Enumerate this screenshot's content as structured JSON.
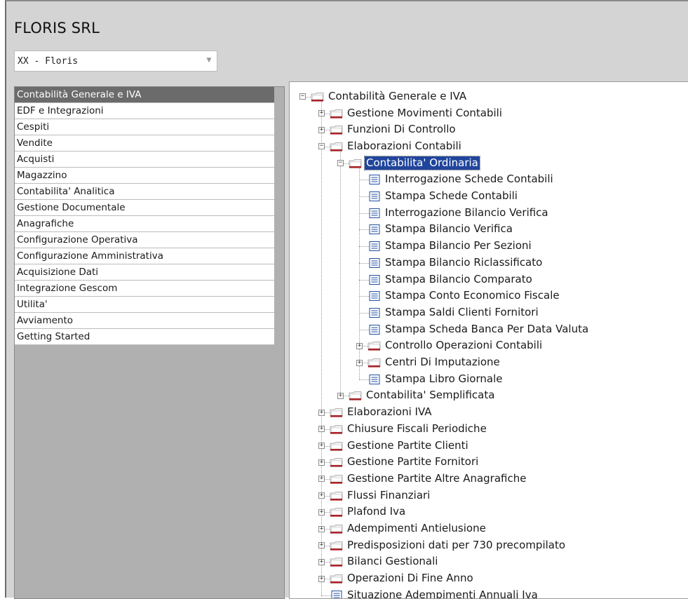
{
  "header": {
    "company_name": "FLORIS SRL",
    "company_select_value": "XX - Floris"
  },
  "left_menu": {
    "items": [
      {
        "label": "Contabilità Generale e IVA",
        "selected": true
      },
      {
        "label": "EDF e Integrazioni"
      },
      {
        "label": "Cespiti"
      },
      {
        "label": "Vendite"
      },
      {
        "label": "Acquisti"
      },
      {
        "label": "Magazzino"
      },
      {
        "label": "Contabilita' Analitica"
      },
      {
        "label": "Gestione Documentale"
      },
      {
        "label": "Anagrafiche"
      },
      {
        "label": "Configurazione Operativa"
      },
      {
        "label": "Configurazione Amministrativa"
      },
      {
        "label": "Acquisizione Dati"
      },
      {
        "label": "Integrazione Gescom"
      },
      {
        "label": "Utilita'"
      },
      {
        "label": "Avviamento"
      },
      {
        "label": "Getting Started"
      }
    ]
  },
  "tree": [
    {
      "label": "Contabilità Generale e IVA",
      "level": 0,
      "type": "folder",
      "expander": "-",
      "open": true
    },
    {
      "label": "Gestione Movimenti Contabili",
      "level": 1,
      "type": "folder",
      "expander": "+"
    },
    {
      "label": "Funzioni Di Controllo",
      "level": 1,
      "type": "folder",
      "expander": "+"
    },
    {
      "label": "Elaborazioni Contabili",
      "level": 1,
      "type": "folder",
      "expander": "-"
    },
    {
      "label": "Contabilita' Ordinaria",
      "level": 2,
      "type": "folder",
      "expander": "-",
      "selected": true
    },
    {
      "label": "Interrogazione Schede Contabili",
      "level": 3,
      "type": "leaf"
    },
    {
      "label": "Stampa Schede Contabili",
      "level": 3,
      "type": "leaf"
    },
    {
      "label": "Interrogazione Bilancio Verifica",
      "level": 3,
      "type": "leaf"
    },
    {
      "label": "Stampa Bilancio Verifica",
      "level": 3,
      "type": "leaf"
    },
    {
      "label": "Stampa Bilancio Per Sezioni",
      "level": 3,
      "type": "leaf"
    },
    {
      "label": "Stampa Bilancio Riclassificato",
      "level": 3,
      "type": "leaf"
    },
    {
      "label": "Stampa Bilancio Comparato",
      "level": 3,
      "type": "leaf"
    },
    {
      "label": "Stampa Conto Economico Fiscale",
      "level": 3,
      "type": "leaf"
    },
    {
      "label": "Stampa Saldi Clienti Fornitori",
      "level": 3,
      "type": "leaf"
    },
    {
      "label": "Stampa Scheda Banca Per Data Valuta",
      "level": 3,
      "type": "leaf"
    },
    {
      "label": "Controllo Operazioni Contabili",
      "level": 3,
      "type": "folder",
      "expander": "+"
    },
    {
      "label": "Centri Di Imputazione",
      "level": 3,
      "type": "folder",
      "expander": "+"
    },
    {
      "label": "Stampa Libro Giornale",
      "level": 3,
      "type": "leaf"
    },
    {
      "label": "Contabilita' Semplificata",
      "level": 2,
      "type": "folder",
      "expander": "+"
    },
    {
      "label": "Elaborazioni IVA",
      "level": 1,
      "type": "folder",
      "expander": "+"
    },
    {
      "label": "Chiusure Fiscali Periodiche",
      "level": 1,
      "type": "folder",
      "expander": "+"
    },
    {
      "label": "Gestione Partite Clienti",
      "level": 1,
      "type": "folder",
      "expander": "+"
    },
    {
      "label": "Gestione Partite Fornitori",
      "level": 1,
      "type": "folder",
      "expander": "+"
    },
    {
      "label": "Gestione Partite Altre Anagrafiche",
      "level": 1,
      "type": "folder",
      "expander": "+"
    },
    {
      "label": "Flussi Finanziari",
      "level": 1,
      "type": "folder",
      "expander": "+"
    },
    {
      "label": "Plafond Iva",
      "level": 1,
      "type": "folder",
      "expander": "+"
    },
    {
      "label": "Adempimenti Antielusione",
      "level": 1,
      "type": "folder",
      "expander": "+"
    },
    {
      "label": "Predisposizioni dati per 730 precompilato",
      "level": 1,
      "type": "folder",
      "expander": "+"
    },
    {
      "label": "Bilanci Gestionali",
      "level": 1,
      "type": "folder",
      "expander": "+"
    },
    {
      "label": "Operazioni Di Fine Anno",
      "level": 1,
      "type": "folder",
      "expander": "+"
    },
    {
      "label": "Situazione Adempimenti Annuali Iva",
      "level": 1,
      "type": "leaf"
    }
  ],
  "colors": {
    "selected_tree_bg": "#20459c",
    "selected_menu_bg": "#6b6b6b",
    "folder_red": "#a8232a"
  }
}
